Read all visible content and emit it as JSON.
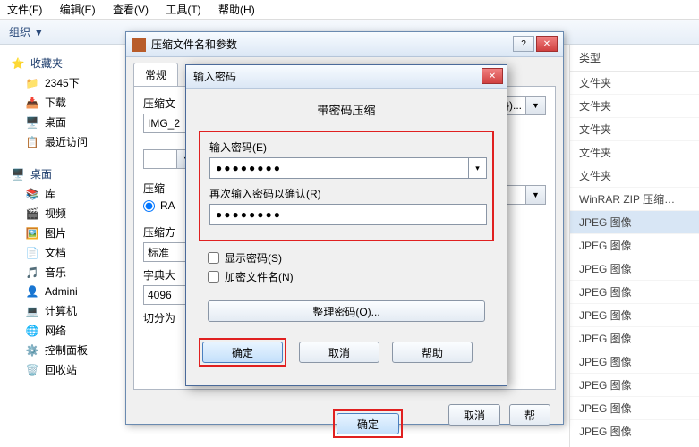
{
  "menubar": [
    "文件(F)",
    "编辑(E)",
    "查看(V)",
    "工具(T)",
    "帮助(H)"
  ],
  "toolbar": {
    "organize": "组织 ▼"
  },
  "sidebar": {
    "fav_header": "收藏夹",
    "fav_items": [
      {
        "icon": "📁",
        "label": "2345下"
      },
      {
        "icon": "📥",
        "label": "下载"
      },
      {
        "icon": "🖥️",
        "label": "桌面"
      },
      {
        "icon": "📋",
        "label": "最近访问"
      }
    ],
    "desk_header": "桌面",
    "desk_items": [
      {
        "icon": "📚",
        "label": "库"
      },
      {
        "icon": "🎬",
        "label": "视频"
      },
      {
        "icon": "🖼️",
        "label": "图片"
      },
      {
        "icon": "📄",
        "label": "文档"
      },
      {
        "icon": "🎵",
        "label": "音乐"
      },
      {
        "icon": "👤",
        "label": "Admini"
      },
      {
        "icon": "💻",
        "label": "计算机"
      },
      {
        "icon": "🌐",
        "label": "网络"
      },
      {
        "icon": "⚙️",
        "label": "控制面板"
      },
      {
        "icon": "🗑️",
        "label": "回收站"
      }
    ]
  },
  "typecol": {
    "header": "类型",
    "rows": [
      "文件夹",
      "文件夹",
      "文件夹",
      "文件夹",
      "文件夹",
      "WinRAR ZIP 压缩…",
      "JPEG 图像",
      "JPEG 图像",
      "JPEG 图像",
      "JPEG 图像",
      "JPEG 图像",
      "JPEG 图像",
      "JPEG 图像",
      "JPEG 图像",
      "JPEG 图像",
      "JPEG 图像"
    ]
  },
  "dlg1": {
    "title": "压缩文件名和参数",
    "tab": "常规",
    "archive_label": "压缩文",
    "archive_value": "IMG_2",
    "profile_label": "压缩",
    "profile_value": "RA",
    "method_label": "压缩方",
    "method_value": "标准",
    "dict_label": "字典大",
    "dict_value": "4096",
    "split_label": "切分为",
    "ok": "确定",
    "cancel": "取消",
    "help": "帮"
  },
  "dlg2": {
    "title": "输入密码",
    "heading": "带密码压缩",
    "pw_label": "输入密码(E)",
    "pw_confirm_label": "再次输入密码以确认(R)",
    "pw_mask": "●●●●●●●●",
    "show_pw": "显示密码(S)",
    "encrypt_names": "加密文件名(N)",
    "organize_pw": "整理密码(O)...",
    "ok": "确定",
    "cancel": "取消",
    "help": "帮助"
  },
  "browse_combo_suffix": "})..."
}
